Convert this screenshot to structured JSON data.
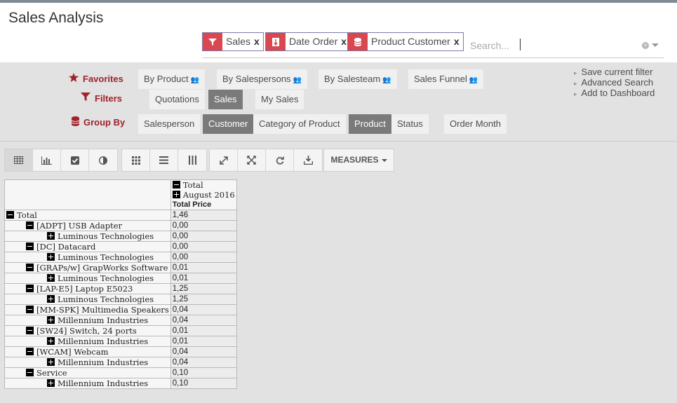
{
  "title": "Sales Analysis",
  "search": {
    "facets": [
      {
        "icon": "filter-icon",
        "value": "Sales",
        "remove": "x"
      },
      {
        "icon": "sort-icon",
        "value": "Date Order",
        "remove": "x"
      },
      {
        "icon": "group-icon",
        "value": "Product  Customer",
        "remove": "x"
      }
    ],
    "placeholder": "Search..."
  },
  "panel": {
    "favorites": {
      "label": "Favorites",
      "items": [
        "By Product",
        "By Salespersons",
        "By Salesteam",
        "Sales Funnel"
      ]
    },
    "filters": {
      "label": "Filters",
      "items": [
        "Quotations",
        "Sales",
        "My Sales"
      ],
      "selected": "Sales"
    },
    "groupby": {
      "label": "Group By",
      "items": [
        "Salesperson",
        "Customer",
        "Category of Product",
        "Product",
        "Status",
        "Order Month"
      ],
      "selected": [
        "Customer",
        "Product"
      ]
    },
    "links": [
      "Save current filter",
      "Advanced Search",
      "Add to Dashboard"
    ]
  },
  "toolbar": {
    "view_buttons": [
      "table-icon",
      "bar-chart-icon",
      "checkbox-icon",
      "pie-icon"
    ],
    "layout_buttons": [
      "grid-icon",
      "rows-icon",
      "columns-icon"
    ],
    "action_buttons": [
      "expand-icon",
      "collapse-icon",
      "refresh-icon",
      "download-icon"
    ],
    "measures_label": "MEASURES"
  },
  "pivot": {
    "col_total": "Total",
    "col_sub": "August 2016",
    "measure": "Total Price",
    "rows": [
      {
        "label": "Total",
        "value": "1,46",
        "level": 0,
        "sign": "minus"
      },
      {
        "label": "[ADPT] USB Adapter",
        "value": "0,00",
        "level": 1,
        "sign": "minus"
      },
      {
        "label": "Luminous Technologies",
        "value": "0,00",
        "level": 2,
        "sign": "plus"
      },
      {
        "label": "[DC] Datacard",
        "value": "0,00",
        "level": 1,
        "sign": "minus"
      },
      {
        "label": "Luminous Technologies",
        "value": "0,00",
        "level": 2,
        "sign": "plus"
      },
      {
        "label": "[GRAPs/w] GrapWorks Software",
        "value": "0,01",
        "level": 1,
        "sign": "minus"
      },
      {
        "label": "Luminous Technologies",
        "value": "0,01",
        "level": 2,
        "sign": "plus"
      },
      {
        "label": "[LAP-E5] Laptop E5023",
        "value": "1,25",
        "level": 1,
        "sign": "minus"
      },
      {
        "label": "Luminous Technologies",
        "value": "1,25",
        "level": 2,
        "sign": "plus"
      },
      {
        "label": "[MM-SPK] Multimedia Speakers",
        "value": "0,04",
        "level": 1,
        "sign": "minus"
      },
      {
        "label": "Millennium Industries",
        "value": "0,04",
        "level": 2,
        "sign": "plus"
      },
      {
        "label": "[SW24] Switch, 24 ports",
        "value": "0,01",
        "level": 1,
        "sign": "minus"
      },
      {
        "label": "Millennium Industries",
        "value": "0,01",
        "level": 2,
        "sign": "plus"
      },
      {
        "label": "[WCAM] Webcam",
        "value": "0,04",
        "level": 1,
        "sign": "minus"
      },
      {
        "label": "Millennium Industries",
        "value": "0,04",
        "level": 2,
        "sign": "plus"
      },
      {
        "label": "Service",
        "value": "0,10",
        "level": 1,
        "sign": "minus"
      },
      {
        "label": "Millennium Industries",
        "value": "0,10",
        "level": 2,
        "sign": "plus"
      }
    ]
  }
}
